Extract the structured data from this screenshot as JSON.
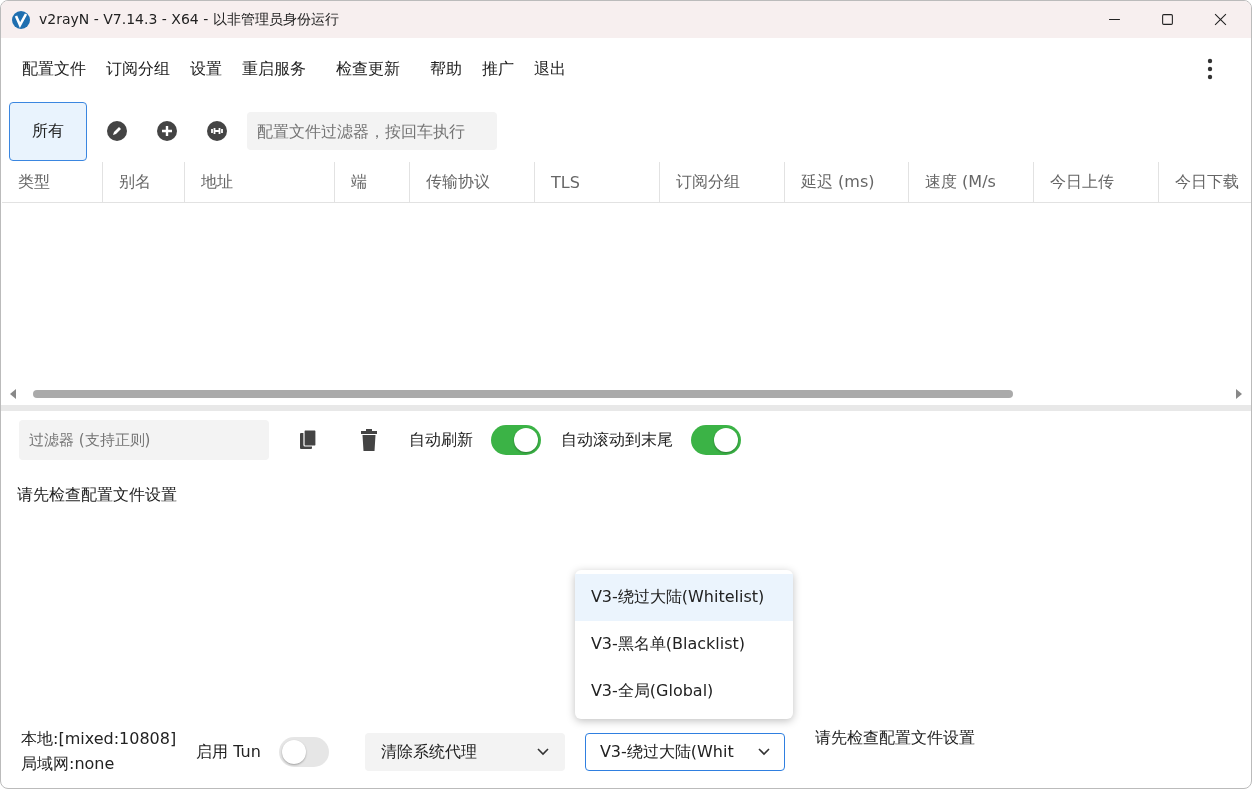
{
  "window": {
    "title": "v2rayN - V7.14.3 - X64 - 以非管理员身份运行"
  },
  "menu": [
    {
      "label": "配置文件"
    },
    {
      "label": "订阅分组"
    },
    {
      "label": "设置"
    },
    {
      "label": "重启服务"
    },
    {
      "label": "检查更新"
    },
    {
      "label": "帮助"
    },
    {
      "label": "推广"
    },
    {
      "label": "退出"
    }
  ],
  "group_tabs": [
    {
      "label": "所有",
      "selected": true
    }
  ],
  "profile_filter": {
    "placeholder": "配置文件过滤器，按回车执行"
  },
  "table": {
    "columns": [
      "类型",
      "别名",
      "地址",
      "端",
      "传输协议",
      "TLS",
      "订阅分组",
      "延迟 (ms)",
      "速度 (M/s",
      "今日上传",
      "今日下载"
    ]
  },
  "log": {
    "filter": {
      "placeholder": "过滤器 (支持正则)"
    },
    "toggles": [
      {
        "label": "自动刷新",
        "on": true
      },
      {
        "label": "自动滚动到末尾",
        "on": true
      }
    ],
    "text": "请先检查配置文件设置"
  },
  "status": {
    "local": "本地:[mixed:10808]",
    "lan": "局域网:none",
    "tun": {
      "label": "启用 Tun",
      "on": false
    },
    "proxy_select": "清除系统代理",
    "routing_select": "V3-绕过大陆(Whit",
    "routing_options": [
      {
        "label": "V3-绕过大陆(Whitelist)",
        "selected": true
      },
      {
        "label": "V3-黑名单(Blacklist)",
        "selected": false
      },
      {
        "label": "V3-全局(Global)",
        "selected": false
      }
    ],
    "message": "请先检查配置文件设置"
  }
}
